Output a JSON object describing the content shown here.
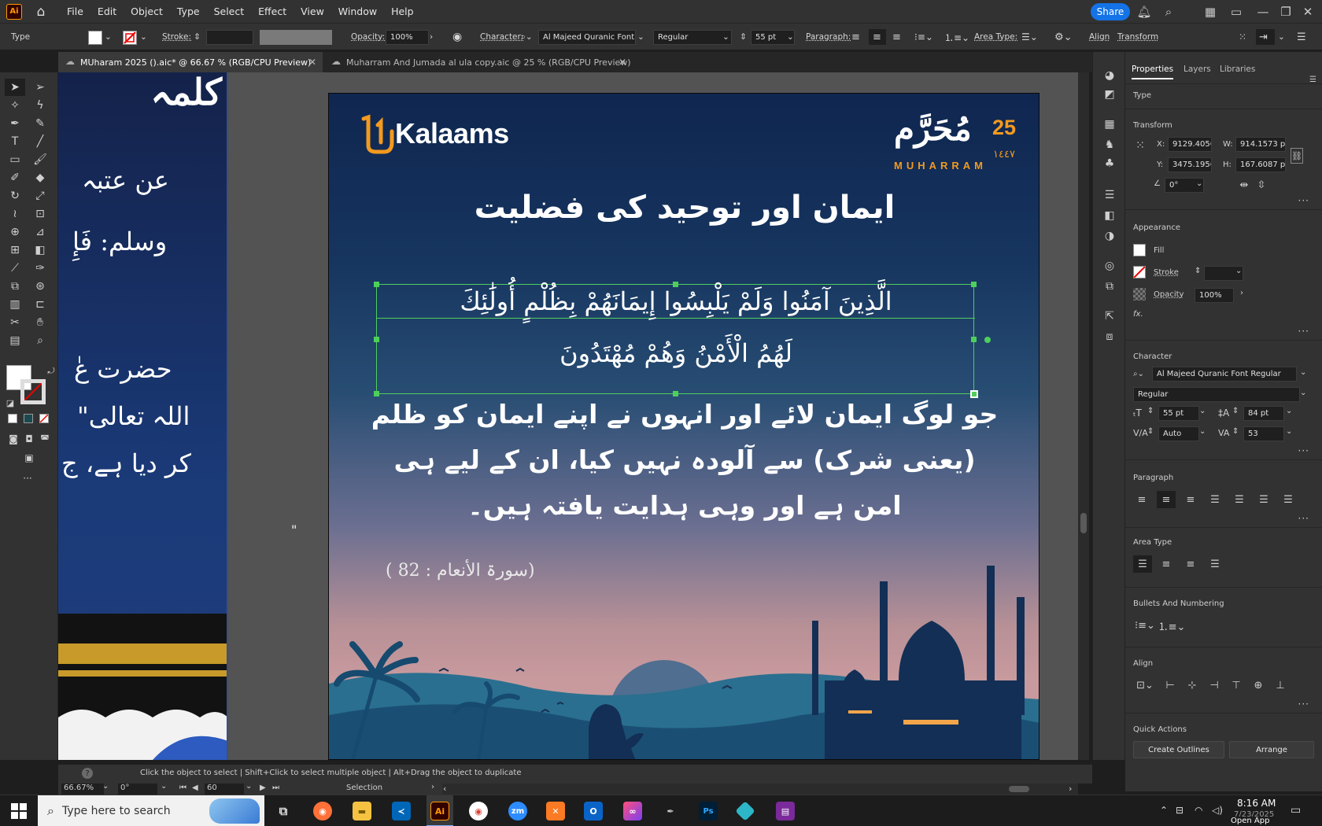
{
  "menubar": {
    "logo": "Ai",
    "items": [
      "File",
      "Edit",
      "Object",
      "Type",
      "Select",
      "Effect",
      "View",
      "Window",
      "Help"
    ],
    "share": "Share"
  },
  "control": {
    "type_label": "Type",
    "stroke_label": "Stroke:",
    "opacity_label": "Opacity:",
    "opacity_value": "100%",
    "character_label": "Character:",
    "font_name": "Al Majeed Quranic Font...",
    "font_style": "Regular",
    "font_size": "55 pt",
    "paragraph_label": "Paragraph:",
    "area_type_label": "Area Type:",
    "align_label": "Align",
    "transform_label": "Transform"
  },
  "tabs": [
    {
      "label": "MUharam 2025 ().aic* @ 66.67 % (RGB/CPU Preview)"
    },
    {
      "label": "Muharram And Jumada al ula copy.aic @ 25 % (RGB/CPU Preview)"
    }
  ],
  "left_art": {
    "line1": "كلمہ",
    "line2": "عن عتبہ",
    "line3": "وسلم: فَإِ",
    "line4": "حضرت عٰ",
    "line5": "\"اللہ تعالی",
    "line6": "کر دیا ہے، ج"
  },
  "artboard": {
    "logo_text": "Kalaams",
    "date_num": "25",
    "month_ar": "مُحَرَّم",
    "year": "١٤٤٧",
    "month_en": "MUHARRAM",
    "title": "ایمان اور توحید کی فضلیت",
    "verse_line1": "الَّذِينَ آمَنُوا وَلَمْ يَلْبِسُوا إِيمَانَهُمْ بِظُلْمٍ أُولَٰئِكَ",
    "verse_line2": "لَهُمُ الْأَمْنُ وَهُمْ مُهْتَدُونَ",
    "translation_line1": "جو لوگ ایمان لائے اور انہوں نے اپنے ایمان کو ظلم",
    "translation_line2": "(یعنی شرک) سے آلودہ نہیں کیا، ان کے لیے ہی",
    "translation_line3": "امن ہے اور وہی ہدایت یافتہ ہیں۔",
    "reference": "(سورۃ الأنعام : 82 )"
  },
  "panel": {
    "tabs": [
      "Properties",
      "Layers",
      "Libraries"
    ],
    "type": "Type",
    "transform_header": "Transform",
    "x_label": "X:",
    "x_value": "9129.4056",
    "y_label": "Y:",
    "y_value": "3475.1956",
    "w_label": "W:",
    "w_value": "914.1573 p",
    "h_label": "H:",
    "h_value": "167.6087 p",
    "angle_value": "0°",
    "appearance_header": "Appearance",
    "fill_label": "Fill",
    "stroke_label": "Stroke",
    "opacity_label": "Opacity",
    "opacity_value": "100%",
    "fx_label": "fx.",
    "character_header": "Character",
    "font_name": "Al Majeed Quranic Font Regular",
    "font_style": "Regular",
    "font_size": "55 pt",
    "leading": "84 pt",
    "kerning": "Auto",
    "tracking": "53",
    "paragraph_header": "Paragraph",
    "area_type_header": "Area Type",
    "bullets_header": "Bullets And Numbering",
    "align_header": "Align",
    "quick_actions_header": "Quick Actions",
    "create_outlines": "Create Outlines",
    "arrange": "Arrange"
  },
  "status": {
    "hint": "Click the object to select  |  Shift+Click to select multiple object  |  Alt+Drag the object to duplicate",
    "zoom": "66.67%",
    "rotation": "0°",
    "artboard_num": "60",
    "tool": "Selection"
  },
  "taskbar": {
    "search_placeholder": "Type here to search",
    "time": "8:16 AM",
    "date": "7/23/2025",
    "open_app": "Open App"
  },
  "colors": {
    "accent": "#1473e6",
    "selection": "#4ecf5c",
    "kalaams_orange": "#f39a1e"
  }
}
